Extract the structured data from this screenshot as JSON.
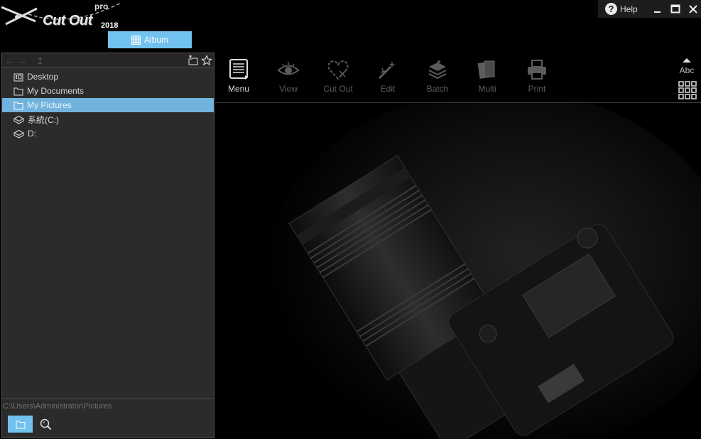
{
  "app": {
    "logo_text": "Cut Out",
    "logo_pro": "pro",
    "logo_year": "2018",
    "album_tab": "Album",
    "help_label": "Help"
  },
  "sidebar": {
    "items": [
      {
        "label": "Desktop",
        "icon": "desktop-icon"
      },
      {
        "label": "My Documents",
        "icon": "folder-icon"
      },
      {
        "label": "My Pictures",
        "icon": "folder-icon",
        "selected": true
      },
      {
        "label": "系統(C:)",
        "icon": "drive-icon"
      },
      {
        "label": "D:",
        "icon": "drive-icon"
      }
    ],
    "path": "C:\\Users\\Administrator\\Pictures"
  },
  "toolbar": {
    "tools": [
      {
        "label": "Menu",
        "icon": "menu-icon",
        "active": true
      },
      {
        "label": "View",
        "icon": "eye-icon",
        "active": false
      },
      {
        "label": "Cut Out",
        "icon": "heart-scissors-icon",
        "active": false
      },
      {
        "label": "Edit",
        "icon": "magic-wand-icon",
        "active": false
      },
      {
        "label": "Batch",
        "icon": "stack-icon",
        "active": false
      },
      {
        "label": "Multi",
        "icon": "pages-icon",
        "active": false
      },
      {
        "label": "Print",
        "icon": "printer-icon",
        "active": false
      }
    ],
    "sort_label": "Abc"
  },
  "colors": {
    "accent": "#72c2ef",
    "selected_row": "#72b3de",
    "panel_bg": "#2b2b2b"
  }
}
